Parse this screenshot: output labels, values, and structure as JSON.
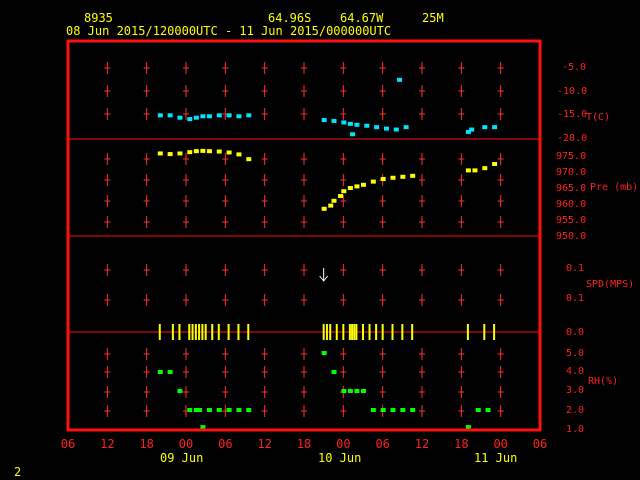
{
  "header": {
    "station": "8935",
    "lat": "64.96S",
    "lon": "64.67W",
    "elev": "25M",
    "range": "08 Jun 2015/120000UTC - 11 Jun 2015/000000UTC"
  },
  "footer": {
    "page": "2"
  },
  "colors": {
    "frame": "#ff1010",
    "grid": "#ff3030",
    "temp": "#00e5ff",
    "pressure": "#ffff00",
    "wind": "#ffff00",
    "rh": "#00ff00",
    "text": "#ffff00",
    "background": "#000000"
  },
  "chart_data": {
    "type": "scatter",
    "time_start": "2015-06-08T06:00Z",
    "time_end": "2015-06-11T06:00Z",
    "x_tick_labels": [
      "06",
      "12",
      "18",
      "00",
      "06",
      "12",
      "18",
      "00",
      "06",
      "12",
      "18",
      "00",
      "06"
    ],
    "date_labels": [
      "09 Jun",
      "10 Jun",
      "11 Jun"
    ],
    "panels": {
      "temperature": {
        "label": "T(C)",
        "ticks": [
          "-5.0",
          "-10.0",
          "-15.0",
          "-20.0"
        ],
        "range": [
          -20.5,
          -4.0
        ],
        "points": [
          [
            "2015-06-08T20:00Z",
            -15.0
          ],
          [
            "2015-06-08T21:30Z",
            -15.0
          ],
          [
            "2015-06-08T23:00Z",
            -15.5
          ],
          [
            "2015-06-09T00:30Z",
            -15.8
          ],
          [
            "2015-06-09T01:30Z",
            -15.5
          ],
          [
            "2015-06-09T02:30Z",
            -15.2
          ],
          [
            "2015-06-09T03:30Z",
            -15.2
          ],
          [
            "2015-06-09T05:00Z",
            -15.0
          ],
          [
            "2015-06-09T06:30Z",
            -15.0
          ],
          [
            "2015-06-09T08:00Z",
            -15.2
          ],
          [
            "2015-06-09T09:30Z",
            -15.0
          ],
          [
            "2015-06-09T21:00Z",
            -16.0
          ],
          [
            "2015-06-09T22:30Z",
            -16.2
          ],
          [
            "2015-06-10T00:00Z",
            -16.5
          ],
          [
            "2015-06-10T01:00Z",
            -16.8
          ],
          [
            "2015-06-10T01:20Z",
            -19.0
          ],
          [
            "2015-06-10T02:00Z",
            -17.0
          ],
          [
            "2015-06-10T03:30Z",
            -17.2
          ],
          [
            "2015-06-10T05:00Z",
            -17.5
          ],
          [
            "2015-06-10T06:30Z",
            -17.8
          ],
          [
            "2015-06-10T08:00Z",
            -18.0
          ],
          [
            "2015-06-10T09:30Z",
            -17.5
          ],
          [
            "2015-06-10T08:30Z",
            -7.5
          ],
          [
            "2015-06-10T19:00Z",
            -18.5
          ],
          [
            "2015-06-10T19:30Z",
            -18.0
          ],
          [
            "2015-06-10T21:30Z",
            -17.5
          ],
          [
            "2015-06-10T23:00Z",
            -17.5
          ]
        ]
      },
      "pressure": {
        "label": "Pre (mb)",
        "ticks": [
          "975.0",
          "970.0",
          "965.0",
          "960.0",
          "955.0",
          "950.0"
        ],
        "range": [
          950.0,
          978.0
        ],
        "points": [
          [
            "2015-06-08T20:00Z",
            975.8
          ],
          [
            "2015-06-08T21:30Z",
            975.6
          ],
          [
            "2015-06-08T23:00Z",
            975.8
          ],
          [
            "2015-06-09T00:30Z",
            976.2
          ],
          [
            "2015-06-09T01:30Z",
            976.5
          ],
          [
            "2015-06-09T02:30Z",
            976.6
          ],
          [
            "2015-06-09T03:30Z",
            976.5
          ],
          [
            "2015-06-09T05:00Z",
            976.4
          ],
          [
            "2015-06-09T06:30Z",
            976.1
          ],
          [
            "2015-06-09T08:00Z",
            975.5
          ],
          [
            "2015-06-09T09:30Z",
            974.0
          ],
          [
            "2015-06-09T21:00Z",
            958.5
          ],
          [
            "2015-06-09T22:00Z",
            959.5
          ],
          [
            "2015-06-09T22:30Z",
            961.0
          ],
          [
            "2015-06-09T23:30Z",
            962.5
          ],
          [
            "2015-06-10T00:00Z",
            964.0
          ],
          [
            "2015-06-10T01:00Z",
            965.0
          ],
          [
            "2015-06-10T02:00Z",
            965.5
          ],
          [
            "2015-06-10T03:00Z",
            966.0
          ],
          [
            "2015-06-10T04:30Z",
            967.0
          ],
          [
            "2015-06-10T06:00Z",
            967.8
          ],
          [
            "2015-06-10T07:30Z",
            968.2
          ],
          [
            "2015-06-10T09:00Z",
            968.5
          ],
          [
            "2015-06-10T10:30Z",
            968.8
          ],
          [
            "2015-06-10T19:00Z",
            970.5
          ],
          [
            "2015-06-10T20:00Z",
            970.5
          ],
          [
            "2015-06-10T21:30Z",
            971.2
          ],
          [
            "2015-06-10T23:00Z",
            972.5
          ]
        ]
      },
      "wind": {
        "label": "SPD(MPS)",
        "ticks": [
          "0.1",
          "0.1",
          "0.0"
        ],
        "observation_times": [
          "2015-06-08T20:00Z",
          "2015-06-08T22:00Z",
          "2015-06-08T23:00Z",
          "2015-06-09T00:30Z",
          "2015-06-09T01:00Z",
          "2015-06-09T01:30Z",
          "2015-06-09T02:00Z",
          "2015-06-09T02:30Z",
          "2015-06-09T03:00Z",
          "2015-06-09T04:00Z",
          "2015-06-09T05:00Z",
          "2015-06-09T06:30Z",
          "2015-06-09T08:00Z",
          "2015-06-09T09:30Z",
          "2015-06-09T21:00Z",
          "2015-06-09T21:30Z",
          "2015-06-09T22:00Z",
          "2015-06-09T23:00Z",
          "2015-06-10T00:00Z",
          "2015-06-10T01:00Z",
          "2015-06-10T01:20Z",
          "2015-06-10T01:40Z",
          "2015-06-10T02:00Z",
          "2015-06-10T03:00Z",
          "2015-06-10T04:00Z",
          "2015-06-10T05:00Z",
          "2015-06-10T06:00Z",
          "2015-06-10T07:30Z",
          "2015-06-10T09:00Z",
          "2015-06-10T10:30Z",
          "2015-06-10T19:00Z",
          "2015-06-10T21:30Z",
          "2015-06-10T23:00Z"
        ],
        "arrow": {
          "time": "2015-06-09T21:00Z",
          "level": 0.1,
          "direction": "down"
        }
      },
      "rh": {
        "label": "RH(%)",
        "ticks": [
          "5.0",
          "4.0",
          "3.0",
          "2.0",
          "1.0"
        ],
        "range": [
          1.0,
          5.5
        ],
        "points": [
          [
            "2015-06-08T20:00Z",
            4.0
          ],
          [
            "2015-06-08T21:30Z",
            4.0
          ],
          [
            "2015-06-08T23:00Z",
            3.0
          ],
          [
            "2015-06-09T00:30Z",
            2.0
          ],
          [
            "2015-06-09T01:30Z",
            2.0
          ],
          [
            "2015-06-09T02:30Z",
            1.1
          ],
          [
            "2015-06-09T03:30Z",
            2.0
          ],
          [
            "2015-06-09T05:00Z",
            2.0
          ],
          [
            "2015-06-09T06:30Z",
            2.0
          ],
          [
            "2015-06-09T08:00Z",
            2.0
          ],
          [
            "2015-06-09T09:30Z",
            2.0
          ],
          [
            "2015-06-09T02:00Z",
            2.0
          ],
          [
            "2015-06-09T21:00Z",
            5.0
          ],
          [
            "2015-06-09T22:30Z",
            4.0
          ],
          [
            "2015-06-10T00:00Z",
            3.0
          ],
          [
            "2015-06-10T01:00Z",
            3.0
          ],
          [
            "2015-06-10T02:00Z",
            3.0
          ],
          [
            "2015-06-10T03:00Z",
            3.0
          ],
          [
            "2015-06-10T04:30Z",
            2.0
          ],
          [
            "2015-06-10T06:00Z",
            2.0
          ],
          [
            "2015-06-10T07:30Z",
            2.0
          ],
          [
            "2015-06-10T09:00Z",
            2.0
          ],
          [
            "2015-06-10T10:30Z",
            2.0
          ],
          [
            "2015-06-10T19:00Z",
            1.1
          ],
          [
            "2015-06-10T20:30Z",
            2.0
          ],
          [
            "2015-06-10T22:00Z",
            2.0
          ]
        ]
      }
    }
  }
}
